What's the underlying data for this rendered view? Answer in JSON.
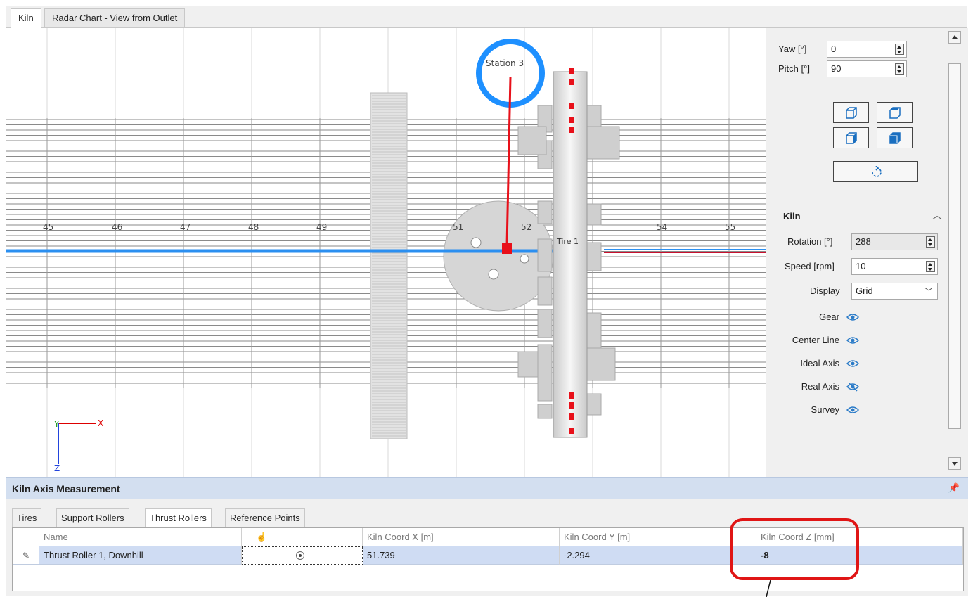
{
  "doc_tabs": [
    {
      "label": "Kiln",
      "active": true
    },
    {
      "label": "Radar Chart - View from Outlet",
      "active": false
    }
  ],
  "viewport": {
    "axis_ticks": [
      "45",
      "46",
      "47",
      "48",
      "49",
      "51",
      "52",
      "54",
      "55"
    ],
    "station_label": "Station 3",
    "tire_label": "Tire 1",
    "axis_x": "X",
    "axis_y": "Y",
    "axis_z": "Z"
  },
  "view_controls": {
    "yaw_label": "Yaw [°]",
    "yaw_value": "0",
    "pitch_label": "Pitch [°]",
    "pitch_value": "90"
  },
  "kiln": {
    "section_title": "Kiln",
    "rotation_label": "Rotation [°]",
    "rotation_value": "288",
    "speed_label": "Speed [rpm]",
    "speed_value": "10",
    "display_label": "Display",
    "display_value": "Grid",
    "visibility": [
      {
        "label": "Gear",
        "icon": "eye-icon"
      },
      {
        "label": "Center Line",
        "icon": "eye-icon"
      },
      {
        "label": "Ideal Axis",
        "icon": "eye-icon"
      },
      {
        "label": "Real Axis",
        "icon": "eye-slash-icon"
      },
      {
        "label": "Survey",
        "icon": "eye-icon"
      }
    ]
  },
  "measurement": {
    "title": "Kiln Axis Measurement",
    "tabs": [
      "Tires",
      "Support Rollers",
      "Thrust Rollers",
      "Reference Points"
    ],
    "active_tab": "Thrust Rollers",
    "columns": [
      "Name",
      "",
      "Kiln Coord X [m]",
      "Kiln Coord Y [m]",
      "Kiln Coord Z [mm]"
    ],
    "rows": [
      {
        "name": "Thrust Roller 1, Downhill",
        "x": "51.739",
        "y": "-2.294",
        "z": "-8"
      }
    ]
  },
  "colors": {
    "accent_blue": "#1e90ff",
    "highlight_red": "#e8101a",
    "selected_row": "#cfdcf3",
    "panel_header": "#d3dff0"
  }
}
